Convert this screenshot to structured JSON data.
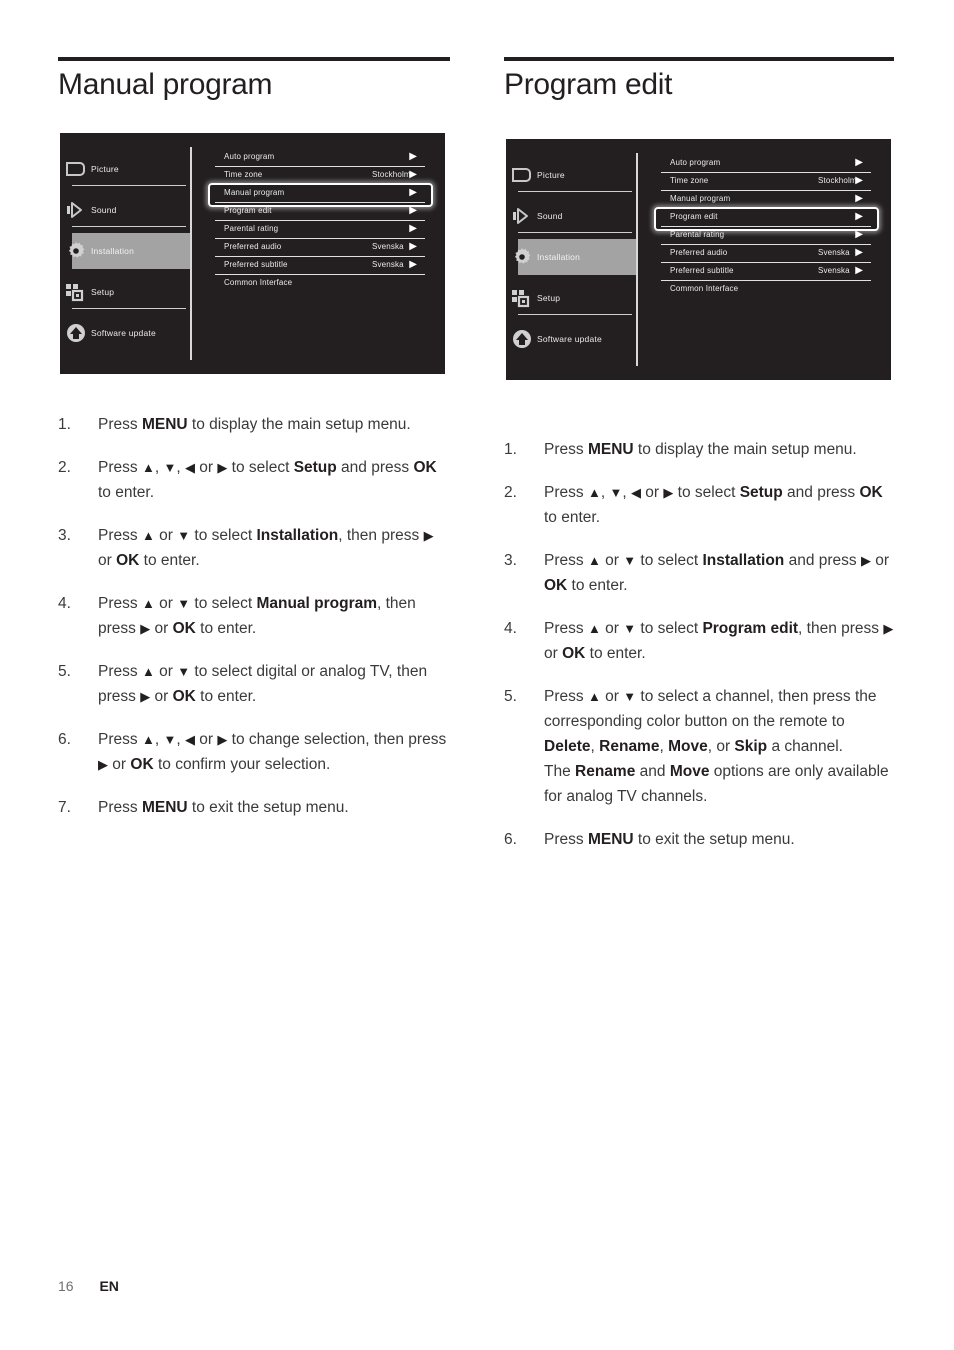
{
  "page": {
    "number": "16",
    "language": "EN"
  },
  "sections": [
    {
      "title": "Manual program",
      "osd": {
        "sidebar": [
          {
            "label": "Picture",
            "icon": "picture-screen-icon",
            "active": false
          },
          {
            "label": "Sound",
            "icon": "speaker-icon",
            "active": false
          },
          {
            "label": "Installation",
            "icon": "gear-icon",
            "active": true
          },
          {
            "label": "Setup",
            "icon": "squares-grid-icon",
            "active": false
          },
          {
            "label": "Software update",
            "icon": "arrow-up-circle-icon",
            "active": false
          }
        ],
        "items": [
          {
            "label": "Auto program",
            "value": "",
            "arrow": true,
            "selected": false,
            "line": true
          },
          {
            "label": "Time zone",
            "value": "Stockholm",
            "arrow": true,
            "selected": false,
            "line": true
          },
          {
            "label": "Manual program",
            "value": "",
            "arrow": true,
            "selected": true,
            "line": true
          },
          {
            "label": "Program edit",
            "value": "",
            "arrow": true,
            "selected": false,
            "line": true
          },
          {
            "label": "Parental rating",
            "value": "",
            "arrow": true,
            "selected": false,
            "line": true
          },
          {
            "label": "Preferred audio",
            "value": "Svenska",
            "arrow": true,
            "selected": false,
            "line": true
          },
          {
            "label": "Preferred subtitle",
            "value": "Svenska",
            "arrow": true,
            "selected": false,
            "line": true
          },
          {
            "label": "Common Interface",
            "value": "",
            "arrow": false,
            "selected": false,
            "line": false
          }
        ]
      },
      "steps": [
        {
          "num": "1.",
          "html": "Press <b>MENU</b> to display the main setup menu."
        },
        {
          "num": "2.",
          "html": "Press <span class=\"arw\">▲</span>, <span class=\"arw\">▼</span>, <span class=\"arw\">◀</span> or <span class=\"arw\">▶</span> to select <b>Setup</b> and press <b>OK</b> to enter."
        },
        {
          "num": "3.",
          "html": "Press <span class=\"arw\">▲</span> or <span class=\"arw\">▼</span> to select <b>Installation</b>, then press <span class=\"arw\">▶</span> or <b>OK</b> to enter."
        },
        {
          "num": "4.",
          "html": "Press <span class=\"arw\">▲</span> or <span class=\"arw\">▼</span> to select <b>Manual program</b>, then press <span class=\"arw\">▶</span> or <b>OK</b> to enter."
        },
        {
          "num": "5.",
          "html": "Press <span class=\"arw\">▲</span> or <span class=\"arw\">▼</span> to select digital or analog TV, then press <span class=\"arw\">▶</span> or <b>OK</b> to enter."
        },
        {
          "num": "6.",
          "html": "Press <span class=\"arw\">▲</span>, <span class=\"arw\">▼</span>, <span class=\"arw\">◀</span> or <span class=\"arw\">▶</span> to change selection, then press <span class=\"arw\">▶</span> or <b>OK</b> to confirm your selection."
        },
        {
          "num": "7.",
          "html": "Press <b>MENU</b> to exit the setup menu."
        }
      ]
    },
    {
      "title": "Program edit",
      "osd": {
        "sidebar": [
          {
            "label": "Picture",
            "icon": "picture-screen-icon",
            "active": false
          },
          {
            "label": "Sound",
            "icon": "speaker-icon",
            "active": false
          },
          {
            "label": "Installation",
            "icon": "gear-icon",
            "active": true
          },
          {
            "label": "Setup",
            "icon": "squares-grid-icon",
            "active": false
          },
          {
            "label": "Software update",
            "icon": "arrow-up-circle-icon",
            "active": false
          }
        ],
        "items": [
          {
            "label": "Auto program",
            "value": "",
            "arrow": true,
            "selected": false,
            "line": true
          },
          {
            "label": "Time zone",
            "value": "Stockholm",
            "arrow": true,
            "selected": false,
            "line": true
          },
          {
            "label": "Manual program",
            "value": "",
            "arrow": true,
            "selected": false,
            "line": true
          },
          {
            "label": "Program edit",
            "value": "",
            "arrow": true,
            "selected": true,
            "line": true
          },
          {
            "label": "Parental rating",
            "value": "",
            "arrow": true,
            "selected": false,
            "line": true
          },
          {
            "label": "Preferred audio",
            "value": "Svenska",
            "arrow": true,
            "selected": false,
            "line": true
          },
          {
            "label": "Preferred subtitle",
            "value": "Svenska",
            "arrow": true,
            "selected": false,
            "line": true
          },
          {
            "label": "Common Interface",
            "value": "",
            "arrow": false,
            "selected": false,
            "line": false
          }
        ]
      },
      "steps": [
        {
          "num": "1.",
          "html": "Press <b>MENU</b> to display the main setup menu."
        },
        {
          "num": "2.",
          "html": "Press <span class=\"arw\">▲</span>, <span class=\"arw\">▼</span>, <span class=\"arw\">◀</span> or <span class=\"arw\">▶</span> to select <b>Setup</b> and press <b>OK</b> to enter."
        },
        {
          "num": "3.",
          "html": "Press <span class=\"arw\">▲</span> or <span class=\"arw\">▼</span> to select <b>Installation</b> and press <span class=\"arw\">▶</span> or <b>OK</b> to enter."
        },
        {
          "num": "4.",
          "html": "Press <span class=\"arw\">▲</span> or <span class=\"arw\">▼</span> to select <b>Program edit</b>, then press <span class=\"arw\">▶</span> or <b>OK</b> to enter."
        },
        {
          "num": "5.",
          "html": "Press <span class=\"arw\">▲</span> or <span class=\"arw\">▼</span> to select a channel, then press the corresponding color button on the remote to <b>Delete</b>, <b>Rename</b>, <b>Move</b>, or <b>Skip</b> a channel.<br>The <b>Rename</b> and <b>Move</b> options are only available for analog TV channels."
        },
        {
          "num": "6.",
          "html": "Press <b>MENU</b> to exit the setup menu."
        }
      ]
    }
  ],
  "colors": {
    "osd_background": "#231f20",
    "osd_text": "#e9e9e9",
    "osd_highlight": "#a3a3a3",
    "selection_outline": "#ffffff",
    "page_text": "#3a3a3a"
  },
  "glyphs": {
    "arrow_right": "▶",
    "arrow_up": "▲",
    "arrow_down": "▼",
    "arrow_left": "◀"
  }
}
